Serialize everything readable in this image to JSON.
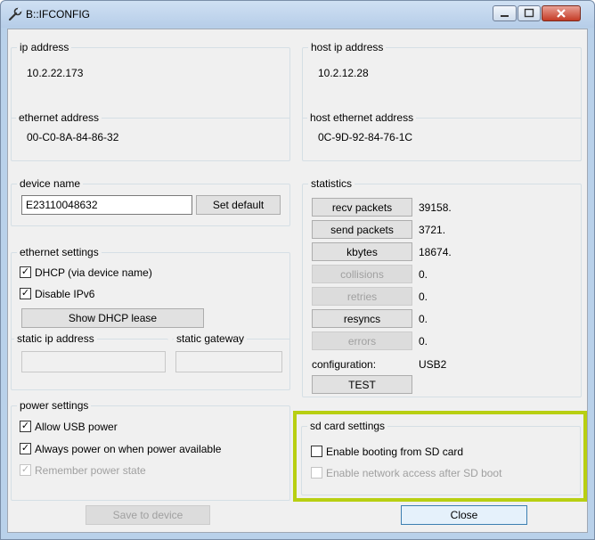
{
  "window": {
    "title": "B::IFCONFIG"
  },
  "network": {
    "ip_address_label": "ip address",
    "ip_address": "10.2.22.173",
    "ethernet_address_label": "ethernet address",
    "ethernet_address": "00-C0-8A-84-86-32",
    "host_ip_address_label": "host ip address",
    "host_ip_address": "10.2.12.28",
    "host_ethernet_address_label": "host ethernet address",
    "host_ethernet_address": "0C-9D-92-84-76-1C"
  },
  "device": {
    "label": "device name",
    "name": "E23110048632",
    "set_default": "Set default"
  },
  "ethernet_settings": {
    "label": "ethernet settings",
    "dhcp": "DHCP (via device name)",
    "disable_ipv6": "Disable IPv6",
    "show_dhcp_lease": "Show DHCP lease",
    "static_ip_label": "static ip address",
    "static_gateway_label": "static gateway"
  },
  "statistics": {
    "label": "statistics",
    "rows": [
      {
        "button": "recv packets",
        "value": "39158."
      },
      {
        "button": "send packets",
        "value": "3721."
      },
      {
        "button": "kbytes",
        "value": "18674."
      },
      {
        "button": "collisions",
        "value": "0."
      },
      {
        "button": "retries",
        "value": "0."
      },
      {
        "button": "resyncs",
        "value": "0."
      },
      {
        "button": "errors",
        "value": "0."
      }
    ],
    "configuration_label": "configuration:",
    "configuration_value": "USB2",
    "test": "TEST"
  },
  "power_settings": {
    "label": "power settings",
    "allow_usb": "Allow USB power",
    "always_on": "Always power on when power available",
    "remember": "Remember power state"
  },
  "sd_card": {
    "label": "sd card settings",
    "enable_booting": "Enable booting from SD card",
    "enable_network": "Enable network access after SD boot"
  },
  "footer": {
    "save": "Save to device",
    "close": "Close"
  },
  "colors": {
    "highlight": "#b8cf12",
    "title_bar": "#b9d1ea",
    "close_button": "#c43b25"
  }
}
